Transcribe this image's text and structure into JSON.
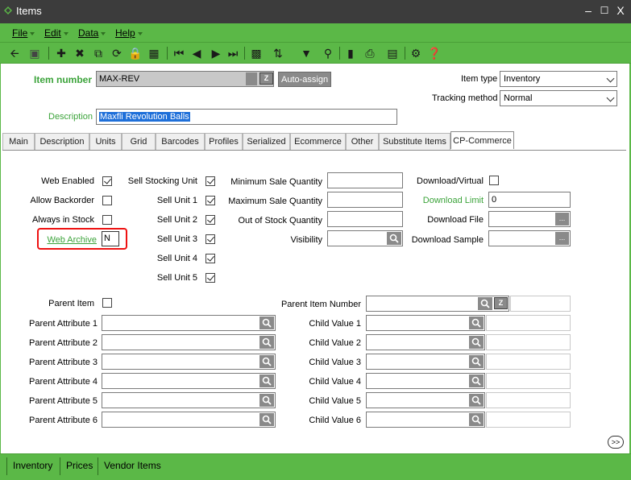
{
  "window": {
    "title": "Items",
    "minimize": "–",
    "maximize": "☐",
    "close": "X"
  },
  "menu": [
    "File",
    "Edit",
    "Data",
    "Help"
  ],
  "header": {
    "item_number_label": "Item number",
    "item_number_value": "MAX-REV",
    "auto_assign_label": "Auto-assign",
    "item_type_label": "Item type",
    "item_type_value": "Inventory",
    "tracking_method_label": "Tracking method",
    "tracking_method_value": "Normal",
    "description_label": "Description",
    "description_value": "Maxfli Revolution Balls"
  },
  "tabs": [
    "Main",
    "Description",
    "Units",
    "Grid",
    "Barcodes",
    "Profiles",
    "Serialized",
    "Ecommerce",
    "Other",
    "Substitute Items",
    "CP-Commerce"
  ],
  "active_tab": "CP-Commerce",
  "col1": {
    "web_enabled": "Web Enabled",
    "allow_backorder": "Allow Backorder",
    "always_in_stock": "Always in Stock",
    "web_archive": "Web Archive",
    "web_archive_value": "N"
  },
  "col2": {
    "sell_stocking_unit": "Sell Stocking Unit",
    "sell_unit_1": "Sell Unit 1",
    "sell_unit_2": "Sell Unit 2",
    "sell_unit_3": "Sell Unit 3",
    "sell_unit_4": "Sell Unit 4",
    "sell_unit_5": "Sell Unit 5"
  },
  "col3": {
    "min_qty": "Minimum Sale Quantity",
    "max_qty": "Maximum Sale Quantity",
    "out_of_stock_qty": "Out of Stock Quantity",
    "visibility": "Visibility"
  },
  "col4": {
    "download_virtual": "Download/Virtual",
    "download_limit": "Download Limit",
    "download_limit_value": "0",
    "download_file": "Download File",
    "download_sample": "Download Sample",
    "ellipsis": "..."
  },
  "parent": {
    "parent_item": "Parent Item",
    "parent_item_number": "Parent Item Number",
    "attributes": [
      "Parent Attribute 1",
      "Parent Attribute 2",
      "Parent Attribute 3",
      "Parent Attribute 4",
      "Parent Attribute 5",
      "Parent Attribute 6"
    ],
    "child_values": [
      "Child Value 1",
      "Child Value 2",
      "Child Value 3",
      "Child Value 4",
      "Child Value 5",
      "Child Value 6"
    ]
  },
  "more_button": ">>",
  "bottom_tabs": [
    "Inventory",
    "Prices",
    "Vendor Items"
  ],
  "colors": {
    "accent": "#5bb847",
    "label_green": "#3ba33a",
    "title_bar": "#3c3c3c",
    "highlight": "#ee1111"
  }
}
